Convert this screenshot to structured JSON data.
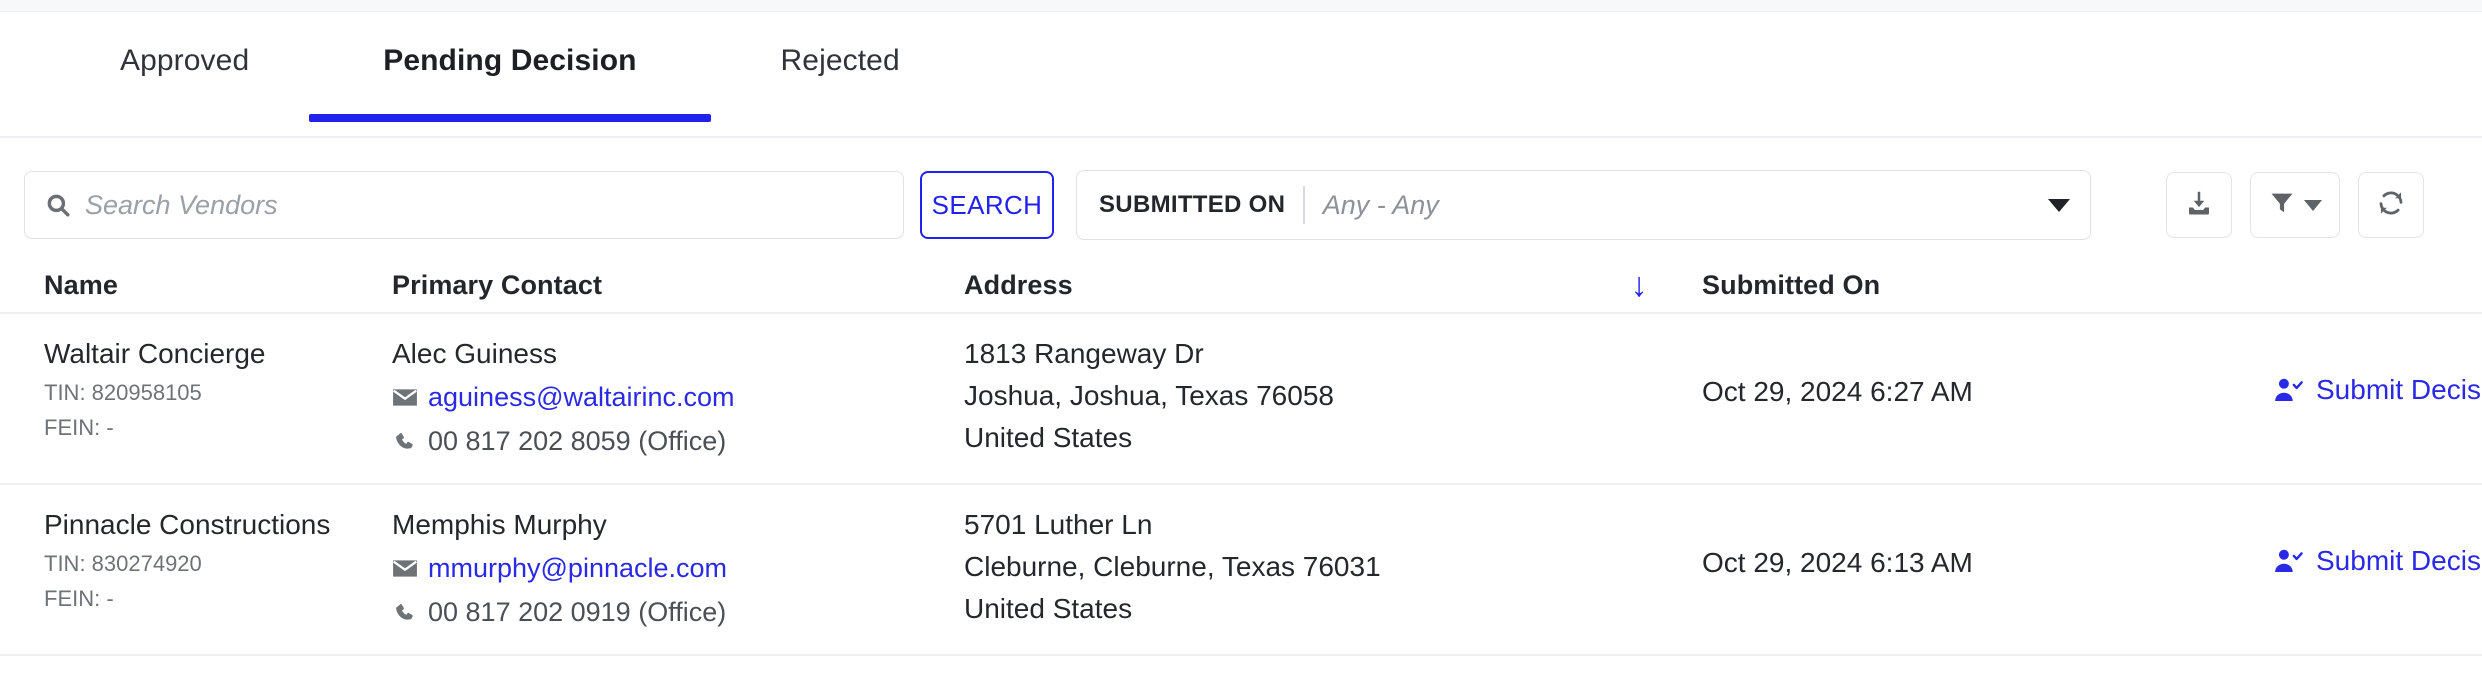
{
  "tabs": [
    {
      "label": "Approved",
      "active": false
    },
    {
      "label": "Pending Decision",
      "active": true
    },
    {
      "label": "Rejected",
      "active": false
    }
  ],
  "toolbar": {
    "search_placeholder": "Search Vendors",
    "search_value": "",
    "search_button": "SEARCH",
    "submitted_on_label": "SUBMITTED ON",
    "submitted_on_value": "Any - Any",
    "download_icon": "download-icon",
    "filter_icon": "filter-icon",
    "refresh_icon": "refresh-icon"
  },
  "table": {
    "headers": {
      "name": "Name",
      "primary_contact": "Primary Contact",
      "address": "Address",
      "sort_arrow": "↓",
      "submitted_on": "Submitted On",
      "action": ""
    },
    "rows": [
      {
        "name": "Waltair Concierge",
        "tin": "TIN: 820958105",
        "fein": "FEIN: -",
        "contact_name": "Alec Guiness",
        "email": "aguiness@waltairinc.com",
        "phone": "00 817 202 8059 (Office)",
        "address_line1": "1813 Rangeway Dr",
        "address_line2": "Joshua, Joshua, Texas 76058",
        "address_line3": "United States",
        "submitted_on": "Oct 29, 2024 6:27 AM",
        "action_label": "Submit Decision"
      },
      {
        "name": "Pinnacle Constructions",
        "tin": "TIN: 830274920",
        "fein": "FEIN: -",
        "contact_name": "Memphis Murphy",
        "email": "mmurphy@pinnacle.com",
        "phone": "00 817 202 0919 (Office)",
        "address_line1": "5701 Luther Ln",
        "address_line2": "Cleburne, Cleburne, Texas 76031",
        "address_line3": "United States",
        "submitted_on": "Oct 29, 2024 6:13 AM",
        "action_label": "Submit Decision"
      }
    ]
  },
  "colors": {
    "accent_blue": "#2222ee",
    "link_blue": "#2a2ae6",
    "text_dark": "#24282c",
    "text_muted": "#6e7378",
    "border": "#e2e4e8"
  }
}
